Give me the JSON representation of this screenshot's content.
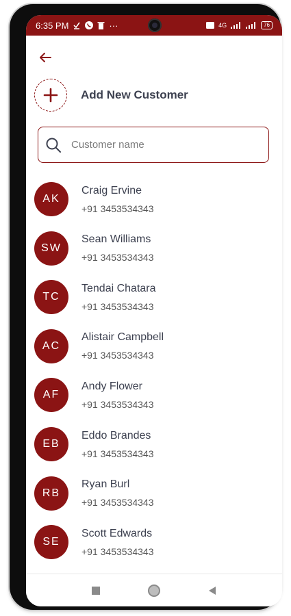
{
  "status": {
    "time": "6:35 PM",
    "network": "4G",
    "battery": "76",
    "dots": "···"
  },
  "add_customer": {
    "label": "Add New Customer"
  },
  "search": {
    "placeholder": "Customer name"
  },
  "customers": [
    {
      "initials": "AK",
      "name": "Craig Ervine",
      "phone": "+91 3453534343"
    },
    {
      "initials": "SW",
      "name": "Sean Williams",
      "phone": "+91 3453534343"
    },
    {
      "initials": "TC",
      "name": "Tendai Chatara",
      "phone": "+91 3453534343"
    },
    {
      "initials": "AC",
      "name": "Alistair Campbell",
      "phone": "+91 3453534343"
    },
    {
      "initials": "AF",
      "name": "Andy Flower",
      "phone": "+91 3453534343"
    },
    {
      "initials": "EB",
      "name": "Eddo Brandes",
      "phone": "+91 3453534343"
    },
    {
      "initials": "RB",
      "name": "Ryan Burl",
      "phone": "+91 3453534343"
    },
    {
      "initials": "SE",
      "name": "Scott Edwards",
      "phone": "+91 3453534343"
    }
  ],
  "colors": {
    "accent": "#8b1414",
    "text": "#3d4150"
  },
  "icons": {
    "back": "arrow-left-icon",
    "add": "plus-icon",
    "search": "search-icon",
    "nav": [
      "square-icon",
      "circle-icon",
      "triangle-back-icon"
    ]
  }
}
